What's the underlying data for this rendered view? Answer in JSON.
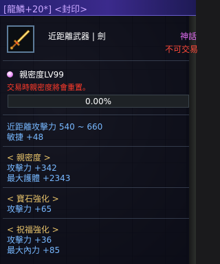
{
  "tooltip": {
    "title": "[龍鱗+20*] <封印>",
    "item_type": "近距離武器 | 劍",
    "right_tag_1": "神話",
    "right_tag_2": "不可交易",
    "icon": "golden-sword-icon",
    "bond": {
      "label": "親密度LV99",
      "warning": "交易時親密度將會重置。",
      "progress_text": "0.00%",
      "progress_value": 0.0
    },
    "base_stats": [
      "近距離攻擊力 540 ~ 660",
      "敏捷 +48"
    ],
    "sections": [
      {
        "header": "< 親密度 >",
        "stats": [
          "攻擊力 +342",
          "最大護體 +2343"
        ]
      },
      {
        "header": "< 寶石強化 >",
        "stats": [
          "攻擊力 +65"
        ]
      },
      {
        "header": "< 祝福強化 >",
        "stats": [
          "攻擊力 +36",
          "最大內力 +85"
        ]
      }
    ]
  },
  "colors": {
    "title_bar": "#3b2a8c",
    "title_text": "#c9a6ff",
    "stat_blue": "#77b8ff",
    "header_gold": "#e8c36a",
    "warning_red": "#ff3a2a",
    "mythic_purple": "#e06cf0",
    "progress_fill": "#4a86c5"
  }
}
